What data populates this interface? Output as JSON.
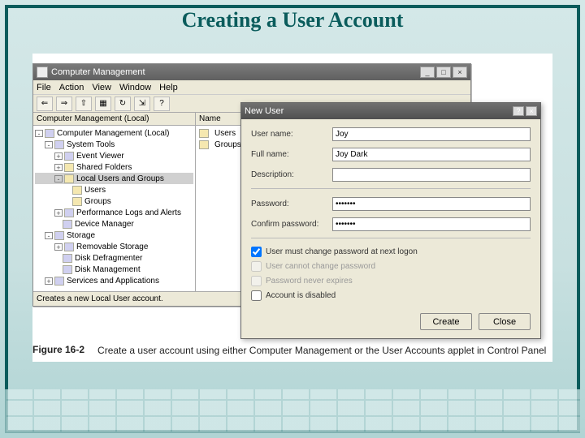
{
  "slide": {
    "title": "Creating a User Account"
  },
  "cm": {
    "title": "Computer Management",
    "menus": [
      "File",
      "Action",
      "View",
      "Window",
      "Help"
    ],
    "toolbar_icons": [
      "back",
      "forward",
      "up",
      "view",
      "refresh",
      "export",
      "help"
    ],
    "tree_header": "Computer Management (Local)",
    "list_header": "Name",
    "tree": {
      "root": "Computer Management (Local)",
      "system_tools": "System Tools",
      "event_viewer": "Event Viewer",
      "shared_folders": "Shared Folders",
      "local_users": "Local Users and Groups",
      "users": "Users",
      "groups": "Groups",
      "perf": "Performance Logs and Alerts",
      "devmgr": "Device Manager",
      "storage": "Storage",
      "removable": "Removable Storage",
      "defrag": "Disk Defragmenter",
      "diskmgmt": "Disk Management",
      "services": "Services and Applications"
    },
    "list": {
      "users": "Users",
      "groups": "Groups"
    },
    "status": "Creates a new Local User account."
  },
  "dlg": {
    "title": "New User",
    "labels": {
      "username": "User name:",
      "fullname": "Full name:",
      "description": "Description:",
      "password": "Password:",
      "confirm": "Confirm password:"
    },
    "values": {
      "username": "Joy",
      "fullname": "Joy Dark",
      "description": "",
      "password": "•••••••",
      "confirm": "•••••••"
    },
    "checks": {
      "must_change": "User must change password at next logon",
      "cannot_change": "User cannot change password",
      "never_expires": "Password never expires",
      "disabled": "Account is disabled"
    },
    "buttons": {
      "create": "Create",
      "close": "Close"
    }
  },
  "figure": {
    "label": "Figure 16-2",
    "text": "Create a user account using either Computer Management or the User Accounts applet in Control Panel"
  }
}
